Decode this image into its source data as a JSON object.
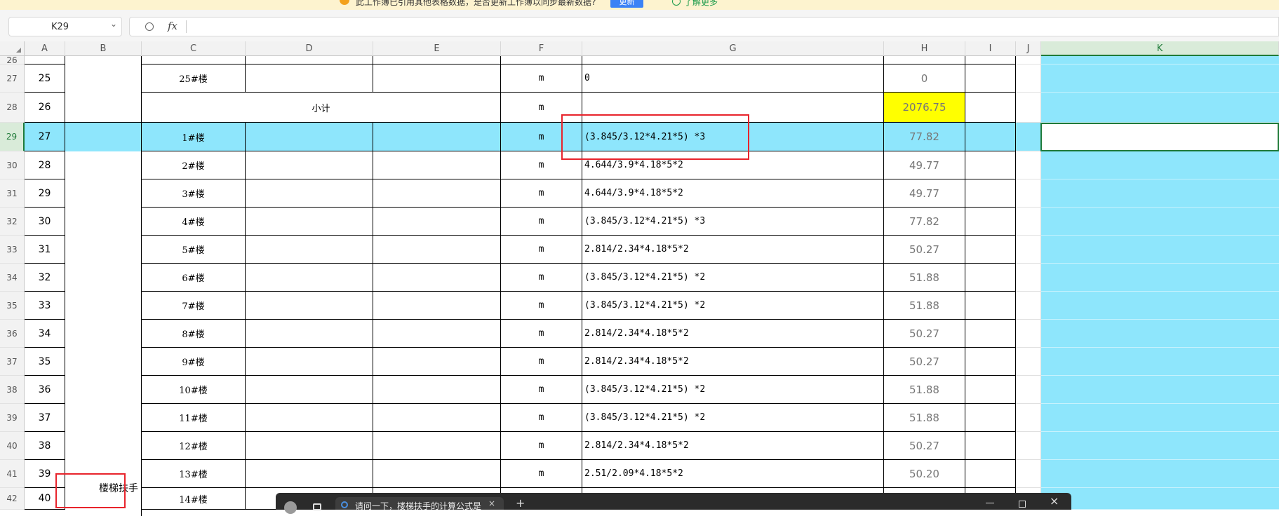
{
  "notice": {
    "message": "此工作簿已引用其他表格数据，是否更新工作簿以同步最新数据?",
    "update_button": "更新",
    "learn_more": "了解更多"
  },
  "formula_bar": {
    "name_box": "K29",
    "fx_label": "fx",
    "formula": ""
  },
  "columns": [
    "A",
    "B",
    "C",
    "D",
    "E",
    "F",
    "G",
    "H",
    "I",
    "J",
    "K"
  ],
  "row_numbers": [
    "26",
    "27",
    "28",
    "29",
    "30",
    "31",
    "32",
    "33",
    "34",
    "35",
    "36",
    "37",
    "38",
    "39",
    "40",
    "41",
    "42"
  ],
  "rows": [
    {
      "a": "25",
      "c": "25#楼",
      "f": "m",
      "g": "0",
      "h": "0"
    },
    {
      "a": "26",
      "subtotal": "小计",
      "f": "m",
      "g": "",
      "h": "2076.75"
    },
    {
      "a": "27",
      "c": "1#楼",
      "f": "m",
      "g": "(3.845/3.12*4.21*5) *3",
      "h": "77.82"
    },
    {
      "a": "28",
      "c": "2#楼",
      "f": "m",
      "g": "4.644/3.9*4.18*5*2",
      "h": "49.77"
    },
    {
      "a": "29",
      "c": "3#楼",
      "f": "m",
      "g": "4.644/3.9*4.18*5*2",
      "h": "49.77"
    },
    {
      "a": "30",
      "c": "4#楼",
      "f": "m",
      "g": "(3.845/3.12*4.21*5) *3",
      "h": "77.82"
    },
    {
      "a": "31",
      "c": "5#楼",
      "f": "m",
      "g": "2.814/2.34*4.18*5*2",
      "h": "50.27"
    },
    {
      "a": "32",
      "c": "6#楼",
      "f": "m",
      "g": "(3.845/3.12*4.21*5) *2",
      "h": "51.88"
    },
    {
      "a": "33",
      "c": "7#楼",
      "f": "m",
      "g": "(3.845/3.12*4.21*5) *2",
      "h": "51.88"
    },
    {
      "a": "34",
      "c": "8#楼",
      "f": "m",
      "g": "2.814/2.34*4.18*5*2",
      "h": "50.27"
    },
    {
      "a": "35",
      "c": "9#楼",
      "f": "m",
      "g": "2.814/2.34*4.18*5*2",
      "h": "50.27"
    },
    {
      "a": "36",
      "c": "10#楼",
      "f": "m",
      "g": "(3.845/3.12*4.21*5) *2",
      "h": "51.88"
    },
    {
      "a": "37",
      "c": "11#楼",
      "f": "m",
      "g": "(3.845/3.12*4.21*5) *2",
      "h": "51.88"
    },
    {
      "a": "38",
      "c": "12#楼",
      "f": "m",
      "g": "2.814/2.34*4.18*5*2",
      "h": "50.27"
    },
    {
      "a": "39",
      "c": "13#楼",
      "f": "m",
      "g": "2.51/2.09*4.18*5*2",
      "h": "50.20"
    },
    {
      "a": "40",
      "c": "14#楼",
      "f": "m",
      "g": "",
      "h": ""
    }
  ],
  "b_label": "楼梯扶手",
  "browser_tab": {
    "title": "请问一下，楼梯扶手的计算公式是",
    "close": "×",
    "new_tab": "+",
    "window_close": "×"
  },
  "colors": {
    "highlight_row": "#8ee6fc",
    "subtotal_fill": "#ffff00",
    "annotation_red": "#e8242c",
    "selection_green": "#1f7a38"
  }
}
